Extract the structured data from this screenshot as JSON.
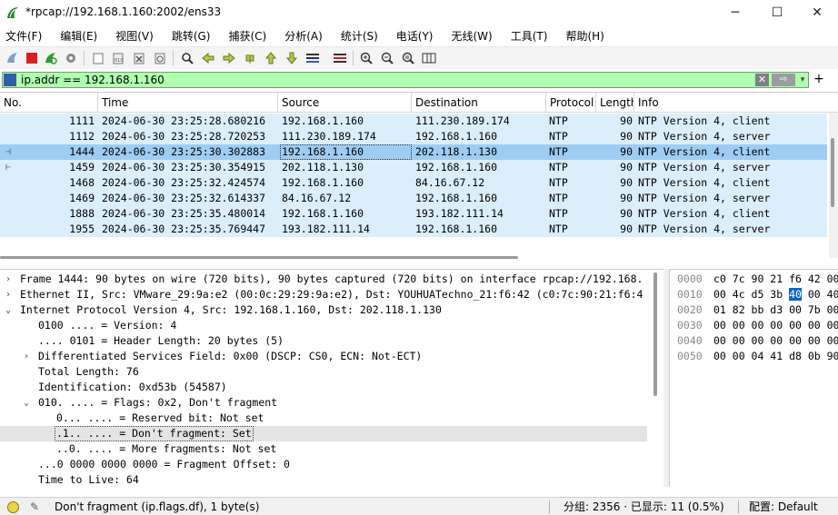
{
  "window": {
    "title": "*rpcap://192.168.1.160:2002/ens33",
    "minimize": "─",
    "maximize": "☐",
    "close": "✕"
  },
  "menu": [
    {
      "label": "文件(F)"
    },
    {
      "label": "编辑(E)"
    },
    {
      "label": "视图(V)"
    },
    {
      "label": "跳转(G)"
    },
    {
      "label": "捕获(C)"
    },
    {
      "label": "分析(A)"
    },
    {
      "label": "统计(S)"
    },
    {
      "label": "电话(Y)"
    },
    {
      "label": "无线(W)"
    },
    {
      "label": "工具(T)"
    },
    {
      "label": "帮助(H)"
    }
  ],
  "filter": {
    "value": "ip.addr == 192.168.1.160",
    "clear_label": "✕",
    "apply_label": "⇨",
    "dropdown_label": "▾",
    "add_label": "+"
  },
  "packet_list": {
    "columns": [
      "No.",
      "Time",
      "Source",
      "Destination",
      "Protocol",
      "Length",
      "Info"
    ],
    "rows": [
      {
        "no": "1111",
        "time": "2024-06-30 23:25:28.680216",
        "source": "192.168.1.160",
        "destination": "111.230.189.174",
        "protocol": "NTP",
        "length": "90",
        "info": "NTP Version 4, client"
      },
      {
        "no": "1112",
        "time": "2024-06-30 23:25:28.720253",
        "source": "111.230.189.174",
        "destination": "192.168.1.160",
        "protocol": "NTP",
        "length": "90",
        "info": "NTP Version 4, server"
      },
      {
        "no": "1444",
        "time": "2024-06-30 23:25:30.302883",
        "source": "192.168.1.160",
        "destination": "202.118.1.130",
        "protocol": "NTP",
        "length": "90",
        "info": "NTP Version 4, client"
      },
      {
        "no": "1459",
        "time": "2024-06-30 23:25:30.354915",
        "source": "202.118.1.130",
        "destination": "192.168.1.160",
        "protocol": "NTP",
        "length": "90",
        "info": "NTP Version 4, server"
      },
      {
        "no": "1468",
        "time": "2024-06-30 23:25:32.424574",
        "source": "192.168.1.160",
        "destination": "84.16.67.12",
        "protocol": "NTP",
        "length": "90",
        "info": "NTP Version 4, client"
      },
      {
        "no": "1469",
        "time": "2024-06-30 23:25:32.614337",
        "source": "84.16.67.12",
        "destination": "192.168.1.160",
        "protocol": "NTP",
        "length": "90",
        "info": "NTP Version 4, server"
      },
      {
        "no": "1888",
        "time": "2024-06-30 23:25:35.480014",
        "source": "192.168.1.160",
        "destination": "193.182.111.14",
        "protocol": "NTP",
        "length": "90",
        "info": "NTP Version 4, client"
      },
      {
        "no": "1955",
        "time": "2024-06-30 23:25:35.769447",
        "source": "193.182.111.14",
        "destination": "192.168.1.160",
        "protocol": "NTP",
        "length": "90",
        "info": "NTP Version 4, server"
      }
    ],
    "selected_no": "1444"
  },
  "details": [
    {
      "arrow": "›",
      "text": "Frame 1444: 90 bytes on wire (720 bits), 90 bytes captured (720 bits) on interface rpcap://192.168.",
      "indent": 0
    },
    {
      "arrow": "›",
      "text": "Ethernet II, Src: VMware_29:9a:e2 (00:0c:29:29:9a:e2), Dst: YOUHUATechno_21:f6:42 (c0:7c:90:21:f6:4",
      "indent": 0
    },
    {
      "arrow": "⌄",
      "text": "Internet Protocol Version 4, Src: 192.168.1.160, Dst: 202.118.1.130",
      "indent": 0
    },
    {
      "arrow": "",
      "text": "0100 .... = Version: 4",
      "indent": 1
    },
    {
      "arrow": "",
      "text": ".... 0101 = Header Length: 20 bytes (5)",
      "indent": 1
    },
    {
      "arrow": "›",
      "text": "Differentiated Services Field: 0x00 (DSCP: CS0, ECN: Not-ECT)",
      "indent": 1
    },
    {
      "arrow": "",
      "text": "Total Length: 76",
      "indent": 1
    },
    {
      "arrow": "",
      "text": "Identification: 0xd53b (54587)",
      "indent": 1
    },
    {
      "arrow": "⌄",
      "text": "010. .... = Flags: 0x2, Don't fragment",
      "indent": 1
    },
    {
      "arrow": "",
      "text": "0... .... = Reserved bit: Not set",
      "indent": 2
    },
    {
      "arrow": "",
      "text": ".1.. .... = Don't fragment: Set",
      "indent": 2
    },
    {
      "arrow": "",
      "text": "..0. .... = More fragments: Not set",
      "indent": 2
    },
    {
      "arrow": "",
      "text": "...0 0000 0000 0000 = Fragment Offset: 0",
      "indent": 1
    },
    {
      "arrow": "",
      "text": "Time to Live: 64",
      "indent": 1
    }
  ],
  "hex": [
    {
      "offset": "0000",
      "pre": "c0 7c 90 21 f6 42 00",
      "sel": "",
      "post": ""
    },
    {
      "offset": "0010",
      "pre": "00 4c d5 3b ",
      "sel": "40",
      "post": " 00 40"
    },
    {
      "offset": "0020",
      "pre": "01 82 bb d3 00 7b 00",
      "sel": "",
      "post": ""
    },
    {
      "offset": "0030",
      "pre": "00 00 00 00 00 00 00",
      "sel": "",
      "post": ""
    },
    {
      "offset": "0040",
      "pre": "00 00 00 00 00 00 00",
      "sel": "",
      "post": ""
    },
    {
      "offset": "0050",
      "pre": "00 00 04 41 d8 0b 90",
      "sel": "",
      "post": ""
    }
  ],
  "status": {
    "field_info": "Don't fragment (ip.flags.df), 1 byte(s)",
    "packets_info": "分组: 2356 · 已显示: 11 (0.5%)",
    "profile": "配置: Default"
  }
}
